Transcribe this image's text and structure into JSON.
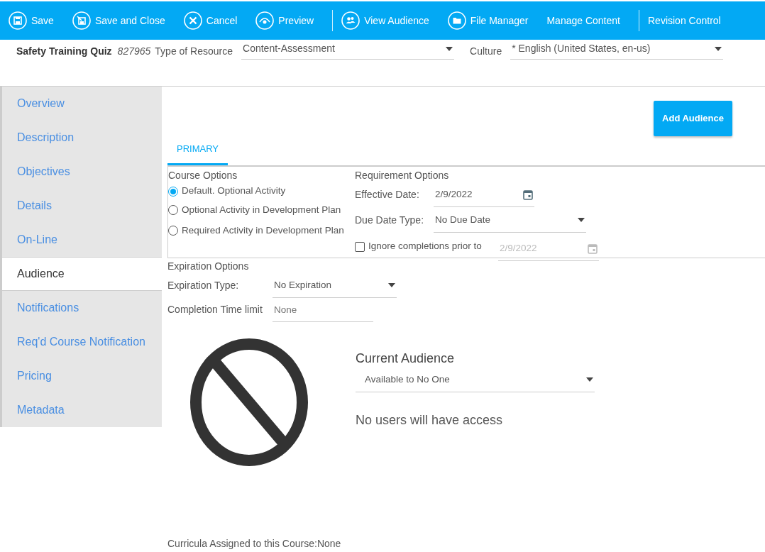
{
  "toolbar": [
    {
      "kind": "icon-button",
      "label": "Save"
    },
    {
      "kind": "icon-button",
      "label": "Save and Close"
    },
    {
      "kind": "icon-button",
      "label": "Cancel"
    },
    {
      "kind": "icon-button",
      "label": "Preview"
    },
    {
      "kind": "separator"
    },
    {
      "kind": "icon-button",
      "label": "View Audience"
    },
    {
      "kind": "icon-button",
      "label": "File Manager"
    },
    {
      "kind": "text-button",
      "label": "Manage Content"
    },
    {
      "kind": "separator"
    },
    {
      "kind": "text-button",
      "label": "Revision Control"
    }
  ],
  "header": {
    "title": "Safety Training Quiz",
    "id": "827965",
    "resource_label": "Type of Resource",
    "resource_value": "Content-Assessment",
    "culture_label": "Culture",
    "culture_value": "* English (United States, en-us)"
  },
  "sidebar": {
    "items": [
      {
        "label": "Overview",
        "selected": false
      },
      {
        "label": "Description",
        "selected": false
      },
      {
        "label": "Objectives",
        "selected": false
      },
      {
        "label": "Details",
        "selected": false
      },
      {
        "label": "On-Line",
        "selected": false
      },
      {
        "label": "Audience",
        "selected": true
      },
      {
        "label": "Notifications",
        "selected": false
      },
      {
        "label": "Req'd Course Notification",
        "selected": false
      },
      {
        "label": "Pricing",
        "selected": false
      },
      {
        "label": "Metadata",
        "selected": false
      }
    ]
  },
  "add_audience_button": "Add Audience",
  "tabs": [
    {
      "label": "PRIMARY",
      "selected": true
    }
  ],
  "course_options": {
    "title": "Course Options",
    "options": [
      {
        "label": "Default. Optional Activity",
        "selected": true
      },
      {
        "label": "Optional Activity in Development Plan",
        "selected": false
      },
      {
        "label": "Required Activity in Development Plan",
        "selected": false
      }
    ]
  },
  "requirement_options": {
    "title": "Requirement Options",
    "effective_date": {
      "label": "Effective Date:",
      "value": "2/9/2022"
    },
    "due_date_type": {
      "label": "Due Date Type:",
      "value": "No Due Date"
    },
    "ignore_completions": {
      "label": "Ignore completions prior to",
      "checked": false,
      "date": "2/9/2022",
      "disabled": true
    }
  },
  "expiration_options": {
    "title": "Expiration Options",
    "expiration_type": {
      "label": "Expiration Type:",
      "value": "No Expiration"
    },
    "completion_time_limit": {
      "label": "Completion Time limit",
      "placeholder": "None"
    }
  },
  "current_audience": {
    "title": "Current Audience",
    "value": "Available to No One",
    "message": "No users will have access"
  },
  "curricula": "Curricula Assigned to this Course:None"
}
